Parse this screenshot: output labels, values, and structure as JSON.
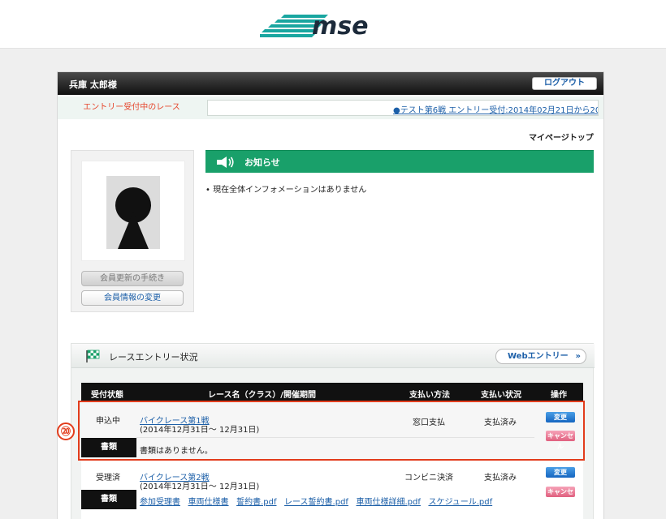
{
  "brand": {
    "logo_text": "mse",
    "accent": "#19a06a"
  },
  "header": {
    "user_name": "兵庫 太郎様",
    "logout_label": "ログアウト"
  },
  "entry_bar": {
    "label": "エントリー受付中のレース",
    "ticker": "●テスト第6戦 エントリー受付:2014年02月21日から20"
  },
  "mypage_link": "マイページトップ",
  "profile": {
    "renew_label": "会員更新の手続き",
    "edit_label": "会員情報の変更"
  },
  "notice": {
    "title": "お知らせ",
    "items": [
      "現在全体インフォメーションはありません"
    ]
  },
  "race_status": {
    "title": "レースエントリー状況",
    "web_entry_label": "Webエントリー",
    "web_entry_arrow": "»",
    "columns": [
      "受付状態",
      "レース名（クラス）/開催期間",
      "支払い方法",
      "支払い状況",
      "操作"
    ],
    "rows": [
      {
        "status": "申込中",
        "race_name": "バイクレース第1戦",
        "period": "(2014年12月31日～ 12月31日)",
        "payment_method": "窓口支払",
        "payment_status": "支払済み",
        "docs_label": "書類",
        "docs_text": "書類はありません。",
        "docs_links": [],
        "change_label": "変更",
        "cancel_label": "キャンセル"
      },
      {
        "status": "受理済",
        "race_name": "バイクレース第2戦",
        "period": "(2014年12月31日～ 12月31日)",
        "payment_method": "コンビニ決済",
        "payment_status": "支払済み",
        "docs_label": "書類",
        "docs_text": "",
        "docs_links": [
          "参加受理書",
          "車両仕様書",
          "誓約書.pdf",
          "レース誓約書.pdf",
          "車両仕様詳細.pdf",
          "スケジュール.pdf"
        ],
        "change_label": "変更",
        "cancel_label": "キャンセル"
      }
    ]
  },
  "annotation": {
    "badge": "⑳",
    "color": "#e23c1c"
  }
}
